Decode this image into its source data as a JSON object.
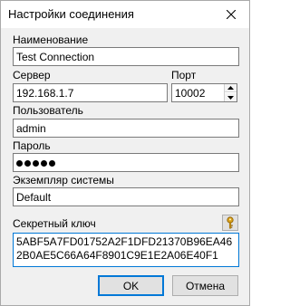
{
  "window": {
    "title": "Настройки соединения",
    "close_glyph": "close-icon"
  },
  "form": {
    "name_label": "Наименование",
    "name_value": "Test Connection",
    "server_label": "Сервер",
    "server_value": "192.168.1.7",
    "port_label": "Порт",
    "port_value": "10002",
    "user_label": "Пользователь",
    "user_value": "admin",
    "password_label": "Пароль",
    "password_masked_length": 5,
    "instance_label": "Экземпляр системы",
    "instance_value": "Default",
    "secret_label": "Секретный ключ",
    "secret_value": "5ABF5A7FD01752A2F1DFD21370B96EA462B0AE5C66A64F8901C9E1E2A06E40F1",
    "key_button_icon": "key-icon"
  },
  "buttons": {
    "ok": "OK",
    "cancel": "Отмена"
  },
  "colors": {
    "focus_border": "#0078d7",
    "dialog_bg": "#f0f0f0",
    "key_icon": "#d9a21b"
  }
}
